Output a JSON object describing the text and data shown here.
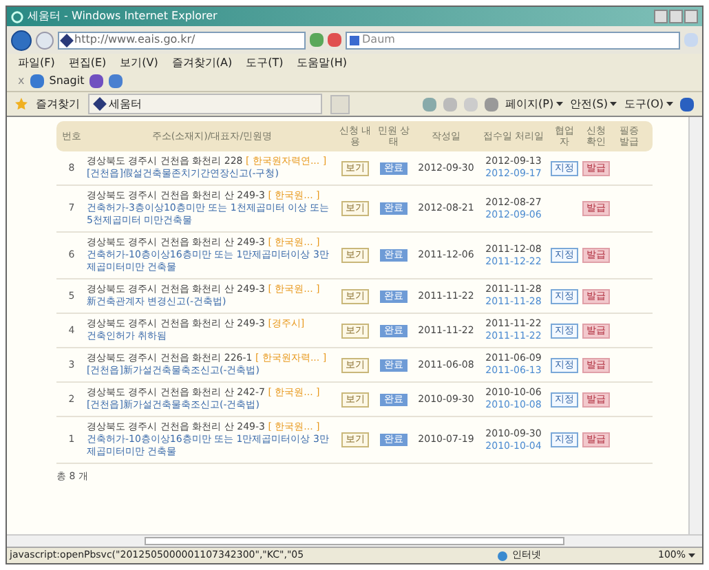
{
  "window": {
    "title": "세움터 - Windows Internet Explorer"
  },
  "address_bar": {
    "url": "http://www.eais.go.kr/"
  },
  "search": {
    "value": "Daum"
  },
  "menu": [
    "파일(F)",
    "편집(E)",
    "보기(V)",
    "즐겨찾기(A)",
    "도구(T)",
    "도움말(H)"
  ],
  "snagit": {
    "close": "x",
    "label": "Snagit"
  },
  "favorites": {
    "label": "즐겨찾기",
    "tab": "세움터"
  },
  "commands": [
    "페이지(P)",
    "안전(S)",
    "도구(O)"
  ],
  "table": {
    "columns": [
      "번호",
      "주소(소재지)/대표자/민원명",
      "신청 내용",
      "민원 상태",
      "작성일",
      "접수일 처리일",
      "협업 자",
      "신청 확인",
      "필증 발급"
    ],
    "rows": [
      {
        "no": "8",
        "address": "경상북도 경주시 건천읍 화천리 228",
        "org": "[ 한국원자력연... ]",
        "title": "[건천읍]假설건축물존치기간연장신고(-구청)",
        "view": "보기",
        "status": "완료",
        "created": "2012-09-30",
        "received": "2012-09-13",
        "processed": "2012-09-17",
        "assignee": "지정",
        "issue": "발급"
      },
      {
        "no": "7",
        "address": "경상북도 경주시 건천읍 화천리 산 249-3",
        "org": "[ 한국원... ]",
        "title": "건축허가-3층이상10층미만 또는 1천제곱미터 이상 또는 5천제곱미터 미만건축물",
        "view": "보기",
        "status": "완료",
        "created": "2012-08-21",
        "received": "2012-08-27",
        "processed": "2012-09-06",
        "issue": "발급"
      },
      {
        "no": "6",
        "address": "경상북도 경주시 건천읍 화천리 산 249-3",
        "org": "[ 한국원... ]",
        "title": "건축허가-10층이상16층미만 또는 1만제곱미터이상 3만제곱미터미만 건축물",
        "view": "보기",
        "status": "완료",
        "created": "2011-12-06",
        "received": "2011-12-08",
        "processed": "2011-12-22",
        "assignee": "지정",
        "issue": "발급"
      },
      {
        "no": "5",
        "address": "경상북도 경주시 건천읍 화천리 산 249-3",
        "org": "[ 한국원... ]",
        "title": "新건축관계자 변경신고(-건축법)",
        "view": "보기",
        "status": "완료",
        "created": "2011-11-22",
        "received": "2011-11-28",
        "processed": "2011-11-28",
        "assignee": "지정",
        "issue": "발급"
      },
      {
        "no": "4",
        "address": "경상북도 경주시 건천읍 화천리 산 249-3",
        "org": "[경주시]",
        "title": "건축인허가 취하됨",
        "view": "보기",
        "status": "완료",
        "created": "2011-11-22",
        "received": "2011-11-22",
        "processed": "2011-11-22",
        "assignee": "지정",
        "issue": "발급"
      },
      {
        "no": "3",
        "address": "경상북도 경주시 건천읍 화천리 226-1",
        "org": "[ 한국원자력... ]",
        "title": "[건천읍]新가설건축물축조신고(-건축법)",
        "view": "보기",
        "status": "완료",
        "created": "2011-06-08",
        "received": "2011-06-09",
        "processed": "2011-06-13",
        "assignee": "지정",
        "issue": "발급"
      },
      {
        "no": "2",
        "address": "경상북도 경주시 건천읍 화천리 산 242-7",
        "org": "[ 한국원... ]",
        "title": "[건천읍]新가설건축물축조신고(-건축법)",
        "view": "보기",
        "status": "완료",
        "created": "2010-09-30",
        "received": "2010-10-06",
        "processed": "2010-10-08",
        "assignee": "지정",
        "issue": "발급"
      },
      {
        "no": "1",
        "address": "경상북도 경주시 건천읍 화천리 산 249-3",
        "org": "[ 한국원... ]",
        "title": "건축허가-10층이상16층미만 또는 1만제곱미터이상 3만제곱미터미만 건축물",
        "view": "보기",
        "status": "완료",
        "created": "2010-07-19",
        "received": "2010-09-30",
        "processed": "2010-10-04",
        "assignee": "지정",
        "issue": "발급"
      }
    ]
  },
  "total": "총 8 개",
  "status_bar": {
    "text": "javascript:openPbsvc(\"2012505000001107342300\",\"KC\",\"05",
    "zone": "인터넷",
    "zoom": "100%"
  }
}
